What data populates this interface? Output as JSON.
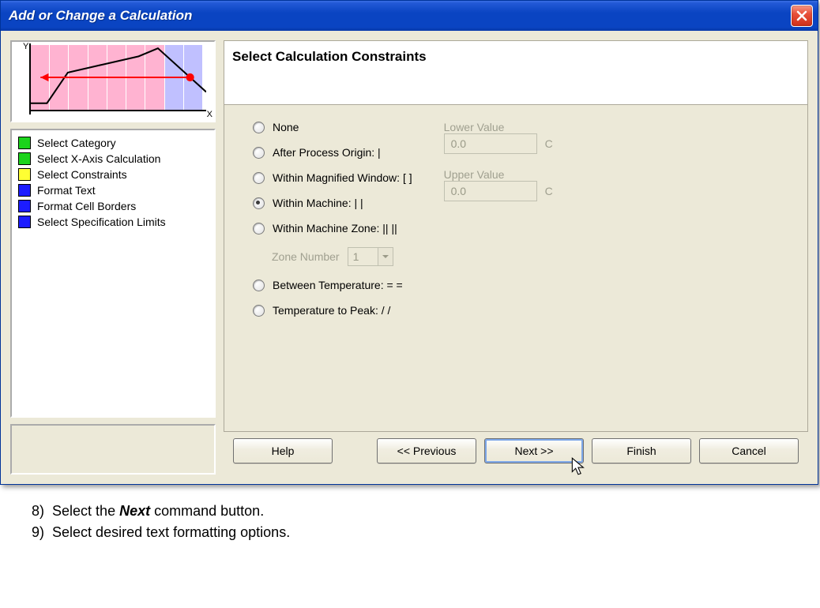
{
  "window": {
    "title": "Add or Change a Calculation"
  },
  "chart": {
    "y_label": "Y",
    "x_label": "X"
  },
  "steps": {
    "items": [
      {
        "label": "Select Category",
        "swatch": "sw-green"
      },
      {
        "label": "Select X-Axis Calculation",
        "swatch": "sw-green"
      },
      {
        "label": "Select Constraints",
        "swatch": "sw-yellow"
      },
      {
        "label": "Format Text",
        "swatch": "sw-blue"
      },
      {
        "label": "Format Cell Borders",
        "swatch": "sw-blue"
      },
      {
        "label": "Select Specification Limits",
        "swatch": "sw-blue"
      }
    ]
  },
  "header": "Select Calculation Constraints",
  "radios": {
    "r0": "None",
    "r1": "After Process Origin: |",
    "r2": "Within Magnified Window: [  ]",
    "r3": "Within Machine: |  |",
    "r4": "Within Machine Zone: ||  ||",
    "r5": "Between Temperature: =  =",
    "r6": "Temperature to Peak: /  /"
  },
  "zone": {
    "label": "Zone Number",
    "value": "1"
  },
  "values": {
    "lower_label": "Lower Value",
    "lower_value": "0.0",
    "lower_unit": "C",
    "upper_label": "Upper Value",
    "upper_value": "0.0",
    "upper_unit": "C"
  },
  "buttons": {
    "help": "Help",
    "prev": "<< Previous",
    "next": "Next >>",
    "finish": "Finish",
    "cancel": "Cancel"
  },
  "instructions": {
    "step8_num": "8)",
    "step8_pre": "Select the ",
    "step8_cmd": "Next",
    "step8_post": " command button.",
    "step9_num": "9)",
    "step9_text": "Select desired text formatting options."
  }
}
